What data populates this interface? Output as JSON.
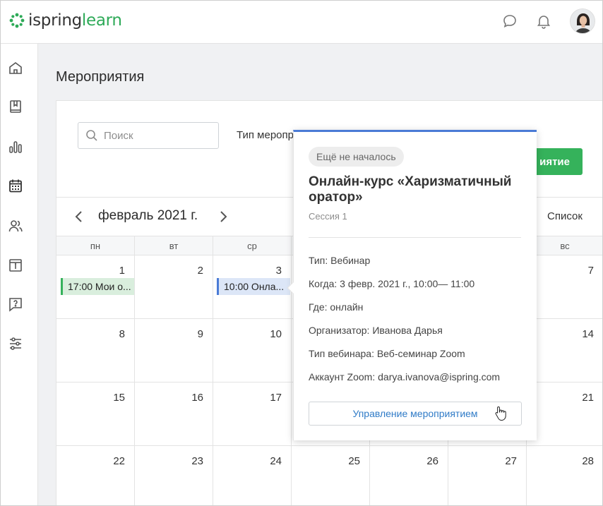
{
  "app": {
    "logo_ispring": "ispring",
    "logo_learn": "learn",
    "brand_color": "#2eaa58"
  },
  "header": {
    "icons": [
      "chat-icon",
      "bell-icon",
      "avatar"
    ]
  },
  "sidebar": {
    "items": [
      "home-icon",
      "book-icon",
      "reports-icon",
      "calendar-icon",
      "users-icon",
      "info-icon",
      "help-icon",
      "settings-icon"
    ]
  },
  "page": {
    "title": "Мероприятия"
  },
  "toolbar": {
    "search_placeholder": "Поиск",
    "type_label": "Тип меропр",
    "create_label": "иятие"
  },
  "calendar": {
    "month_label": "февраль 2021 г.",
    "view_list_label": "Список",
    "weekdays": [
      "пн",
      "вт",
      "ср",
      "",
      "",
      "",
      "вс"
    ],
    "weeks": [
      [
        "1",
        "2",
        "3",
        "",
        "",
        "",
        "7"
      ],
      [
        "8",
        "9",
        "10",
        "",
        "",
        "",
        "14"
      ],
      [
        "15",
        "16",
        "17",
        "",
        "",
        "",
        "21"
      ],
      [
        "22",
        "23",
        "24",
        "25",
        "26",
        "27",
        "28"
      ]
    ],
    "events": {
      "mon": "17:00 Мои о...",
      "wed": "10:00 Онла..."
    }
  },
  "popover": {
    "status": "Ещё не началось",
    "title": "Онлайн-курс «Харизматичный оратор»",
    "session": "Сессия 1",
    "rows": {
      "type": "Тип: Вебинар",
      "when": "Когда: 3 февр. 2021 г., 10:00— 11:00",
      "where": "Где: онлайн",
      "organizer": "Организатор: Иванова Дарья",
      "webinar_type": "Тип вебинара: Веб-семинар Zoom",
      "zoom_account": "Аккаунт Zoom: darya.ivanova@ispring.com"
    },
    "manage_label": "Управление мероприятием"
  }
}
